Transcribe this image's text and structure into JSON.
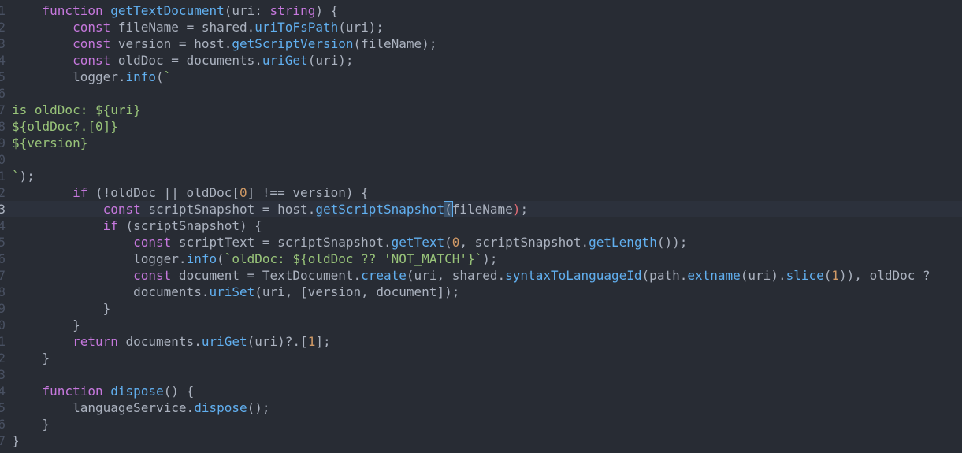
{
  "editor": {
    "theme_colors": {
      "background": "#282c34",
      "current_line": "#2c313c",
      "keyword": "#c678dd",
      "function": "#61afef",
      "string": "#98c379",
      "number": "#d19a66",
      "text": "#abb2bf",
      "line_number": "#495162",
      "cursor": "#528bff"
    },
    "current_line_index": 12,
    "lines": [
      {
        "num": "1",
        "code": "    function getTextDocument(uri: string) {"
      },
      {
        "num": "2",
        "code": "        const fileName = shared.uriToFsPath(uri);"
      },
      {
        "num": "3",
        "code": "        const version = host.getScriptVersion(fileName);"
      },
      {
        "num": "4",
        "code": "        const oldDoc = documents.uriGet(uri);"
      },
      {
        "num": "5",
        "code": "        logger.info(`"
      },
      {
        "num": "6",
        "code": ""
      },
      {
        "num": "7",
        "code": "is oldDoc: ${uri}"
      },
      {
        "num": "8",
        "code": "${oldDoc?.[0]}"
      },
      {
        "num": "9",
        "code": "${version}"
      },
      {
        "num": "0",
        "code": ""
      },
      {
        "num": "1",
        "code": "`);"
      },
      {
        "num": "2",
        "code": "        if (!oldDoc || oldDoc[0] !== version) {"
      },
      {
        "num": "3",
        "code": "            const scriptSnapshot = host.getScriptSnapshot(fileName);"
      },
      {
        "num": "4",
        "code": "            if (scriptSnapshot) {"
      },
      {
        "num": "5",
        "code": "                const scriptText = scriptSnapshot.getText(0, scriptSnapshot.getLength());"
      },
      {
        "num": "6",
        "code": "                logger.info(`oldDoc: ${oldDoc ?? 'NOT_MATCH'}`);"
      },
      {
        "num": "7",
        "code": "                const document = TextDocument.create(uri, shared.syntaxToLanguageId(path.extname(uri).slice(1)), oldDoc ?"
      },
      {
        "num": "8",
        "code": "                documents.uriSet(uri, [version, document]);"
      },
      {
        "num": "9",
        "code": "            }"
      },
      {
        "num": "0",
        "code": "        }"
      },
      {
        "num": "1",
        "code": "        return documents.uriGet(uri)?.[1];"
      },
      {
        "num": "2",
        "code": "    }"
      },
      {
        "num": "3",
        "code": ""
      },
      {
        "num": "4",
        "code": "    function dispose() {"
      },
      {
        "num": "5",
        "code": "        languageService.dispose();"
      },
      {
        "num": "6",
        "code": "    }"
      },
      {
        "num": "7",
        "code": "}"
      }
    ]
  }
}
